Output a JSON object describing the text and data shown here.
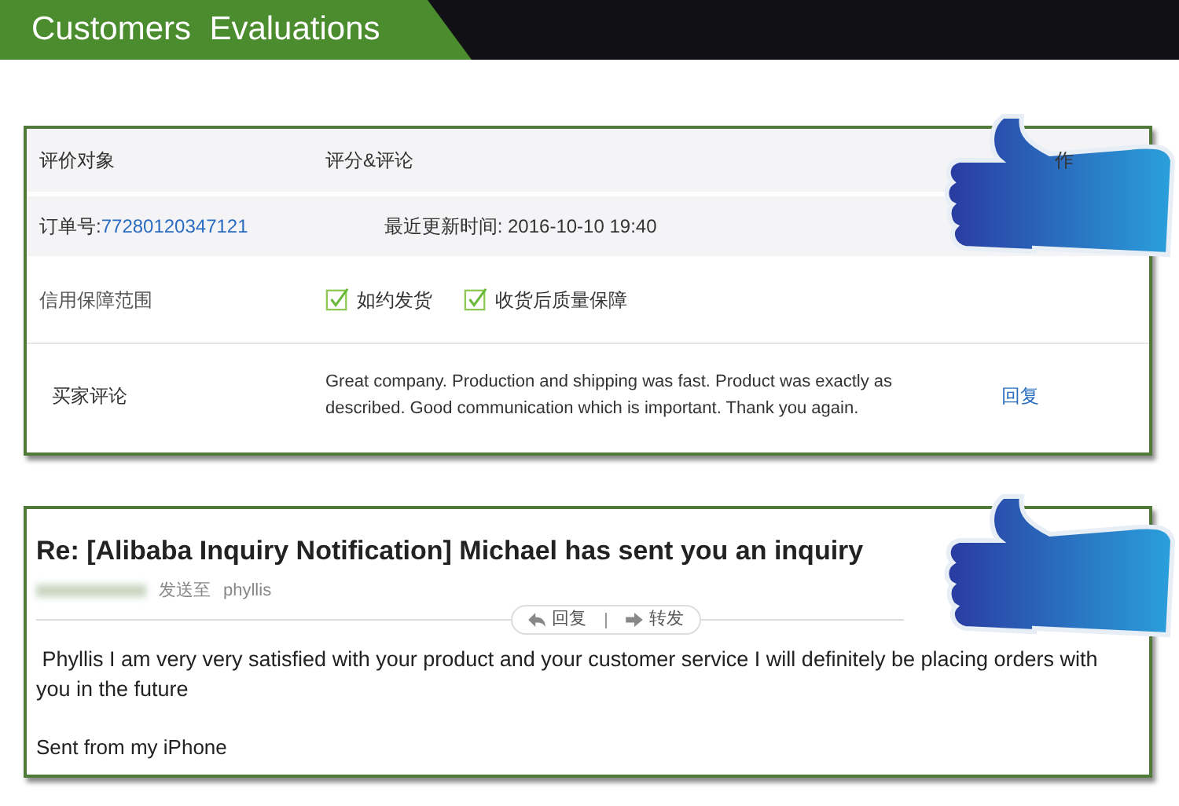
{
  "banner": {
    "title": "Customers  Evaluations"
  },
  "review": {
    "columns": [
      "评价对象",
      "评分&评论",
      "作"
    ],
    "order": {
      "label": "订单号: ",
      "number": "77280120347121",
      "updated": "最近更新时间: 2016-10-10 19:40"
    },
    "guarantee": {
      "label": "信用保障范围",
      "items": [
        {
          "label": "如约发货",
          "checked": true
        },
        {
          "label": "收货后质量保障",
          "checked": true
        }
      ]
    },
    "comment": {
      "label": "买家评论",
      "text": "Great company. Production and shipping was fast. Product was exactly as described. Good communication which is important. Thank you again.",
      "reply": "回复"
    }
  },
  "email": {
    "subject": "Re: [Alibaba Inquiry Notification] Michael has sent you an inquiry",
    "sent_to": "发送至",
    "recipient": "phyllis",
    "actions": [
      {
        "label": "回复",
        "kind": "reply"
      },
      {
        "label": "转发",
        "kind": "forward"
      }
    ],
    "body": " Phyllis I am very very satisfied with your product and your customer service I will definitely be placing orders with you in the future",
    "signature": "Sent from my iPhone"
  }
}
